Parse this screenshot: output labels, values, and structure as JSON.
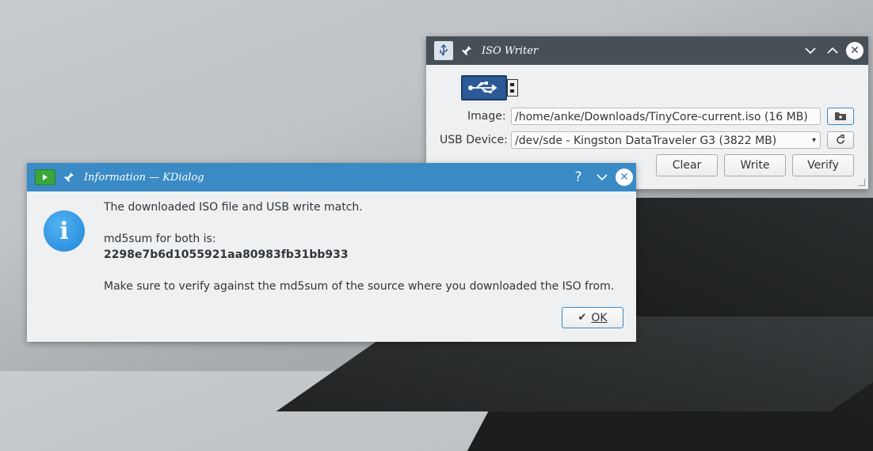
{
  "iso_writer": {
    "title": "ISO Writer",
    "image_label": "Image:",
    "image_value": "/home/anke/Downloads/TinyCore-current.iso (16 MB)",
    "usb_label": "USB Device:",
    "usb_value": "/dev/sde - Kingston DataTraveler G3 (3822 MB)",
    "buttons": {
      "clear": "Clear",
      "write": "Write",
      "verify": "Verify"
    },
    "icons": [
      "usb-app-icon",
      "pin-icon",
      "minimize-icon",
      "maximize-icon",
      "close-icon",
      "usb-stick-icon",
      "open-folder-icon",
      "refresh-icon"
    ]
  },
  "kdialog": {
    "title": "Information — KDialog",
    "line1": "The downloaded ISO file and USB write match.",
    "line2": "md5sum for both is:",
    "md5": "2298e7b6d1055921aa80983fb31bb933",
    "line3": "Make sure to verify against the md5sum of the source where you downloaded the ISO from.",
    "ok_label": "OK",
    "help_glyph": "?",
    "info_glyph": "i"
  },
  "colors": {
    "iso_titlebar": "#475057",
    "kdialog_titlebar": "#3a8ac6",
    "info_icon": "#2a94e0",
    "usb_icon": "#2c5a97"
  }
}
